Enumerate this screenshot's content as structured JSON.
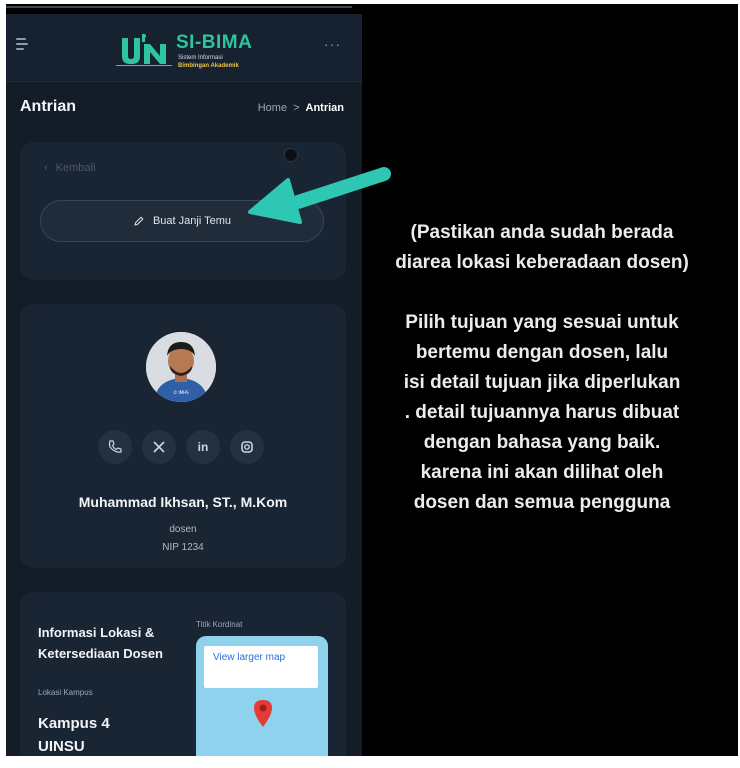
{
  "app": {
    "logo_title": "SI-BIMA",
    "logo_sub1": "Sistem Informasi",
    "logo_sub2": "Bimbingan Akademik",
    "page_title": "Antrian",
    "breadcrumb": {
      "home": "Home",
      "sep": ">",
      "current": "Antrian"
    }
  },
  "action_card": {
    "back_label": "Kembali",
    "make_appointment_label": "Buat Janji Temu"
  },
  "lecturer": {
    "name": "Muhammad Ikhsan, ST., M.Kom",
    "role": "dosen",
    "nip": "NIP 1234",
    "avatar_caption": "© IMHS",
    "socials": {
      "linkedin": "in"
    }
  },
  "location": {
    "title": "Informasi Lokasi & Ketersediaan Dosen",
    "campus_label": "Lokasi Kampus",
    "campus": "Kampus 4 UINSU",
    "coord_label": "Titik Kordinat",
    "map_link": "View larger map"
  },
  "overlay": {
    "line1": "(Pastikan anda sudah berada",
    "line2": "diarea lokasi keberadaan dosen)",
    "p1": "Pilih tujuan yang sesuai untuk",
    "p2": "bertemu dengan dosen, lalu",
    "p3": "isi detail tujuan jika diperlukan",
    "p4": ". detail tujuannya harus dibuat",
    "p5": "dengan bahasa yang baik.",
    "p6": "karena ini akan dilihat oleh",
    "p7": "dosen dan semua pengguna"
  },
  "colors": {
    "brand": "#2ec4a0",
    "arrow": "#2ec7b3",
    "background": "#000000",
    "card": "#1a2533",
    "map_pin": "#e53b35"
  }
}
